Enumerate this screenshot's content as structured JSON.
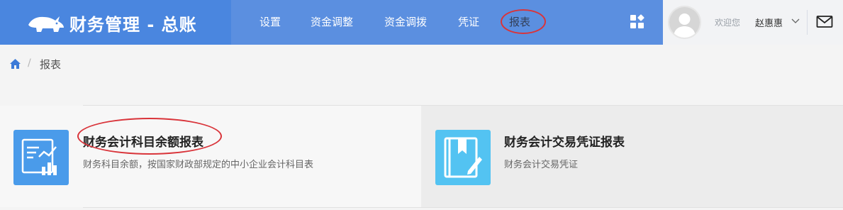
{
  "brand": {
    "title": "财务管理 - 总账"
  },
  "nav": {
    "items": [
      {
        "label": "设置"
      },
      {
        "label": "资金调整"
      },
      {
        "label": "资金调拨"
      },
      {
        "label": "凭证"
      },
      {
        "label": "报表"
      }
    ]
  },
  "user": {
    "welcome": "欢迎您",
    "name": "赵惠惠"
  },
  "breadcrumb": {
    "current": "报表",
    "separator": "/"
  },
  "cards": [
    {
      "title": "财务会计科目余额报表",
      "desc": "财务科目余额，按国家财政部规定的中小企业会计科目表",
      "icon": "report-chart-icon"
    },
    {
      "title": "财务会计交易凭证报表",
      "desc": "财务会计交易凭证",
      "icon": "voucher-book-icon"
    }
  ],
  "colors": {
    "topbar": "#5b8fe0",
    "brand_bg": "#4a86df",
    "card_icon_1": "#4a9bea",
    "card_icon_2": "#53c3f2",
    "annotation_circle": "#d9343a"
  }
}
